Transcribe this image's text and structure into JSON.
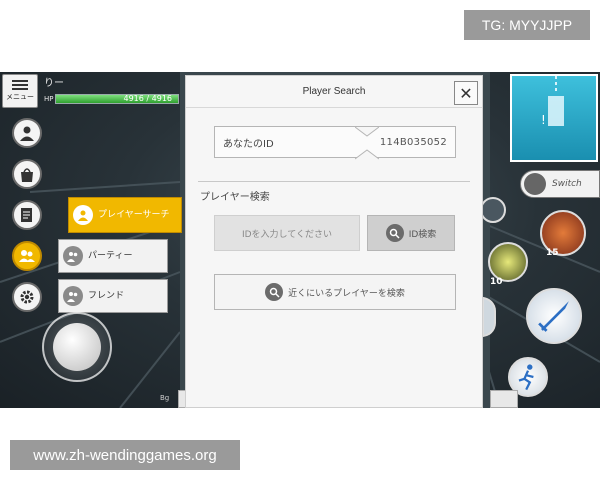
{
  "overlay": {
    "tg_badge": "TG: MYYJJPP",
    "site_badge": "www.zh-wendinggames.org"
  },
  "hud": {
    "menu_label": "メニュー",
    "player_name": "りー",
    "hp_label": "HP",
    "hp_value": "4916 / 4916",
    "hp_fraction": 1.0,
    "tiny_label": "Bg"
  },
  "side_menu": {
    "items": [
      {
        "icon": "person-icon"
      },
      {
        "icon": "bag-icon"
      },
      {
        "icon": "notepad-icon"
      },
      {
        "icon": "friends-icon",
        "active": true
      },
      {
        "icon": "gear-icon"
      }
    ],
    "submenu": {
      "player_search": "プレイヤーサーチ",
      "party": "パーティー",
      "friend": "フレンド"
    }
  },
  "dialog": {
    "title": "Player Search",
    "close_glyph": "✕",
    "my_id_label": "あなたのID",
    "my_id_value": "114B035052",
    "section_label": "プレイヤー検索",
    "id_input_placeholder": "IDを入力してください",
    "id_search_label": "ID検索",
    "nearby_search_label": "近くにいるプレイヤーを検索"
  },
  "right_hud": {
    "switch_label": "Switch",
    "skill_counts": [
      "15",
      "10"
    ]
  },
  "colors": {
    "accent_yellow": "#f1b800",
    "hp_green": "#3cb43c",
    "minimap_blue": "#2aa6c8"
  }
}
